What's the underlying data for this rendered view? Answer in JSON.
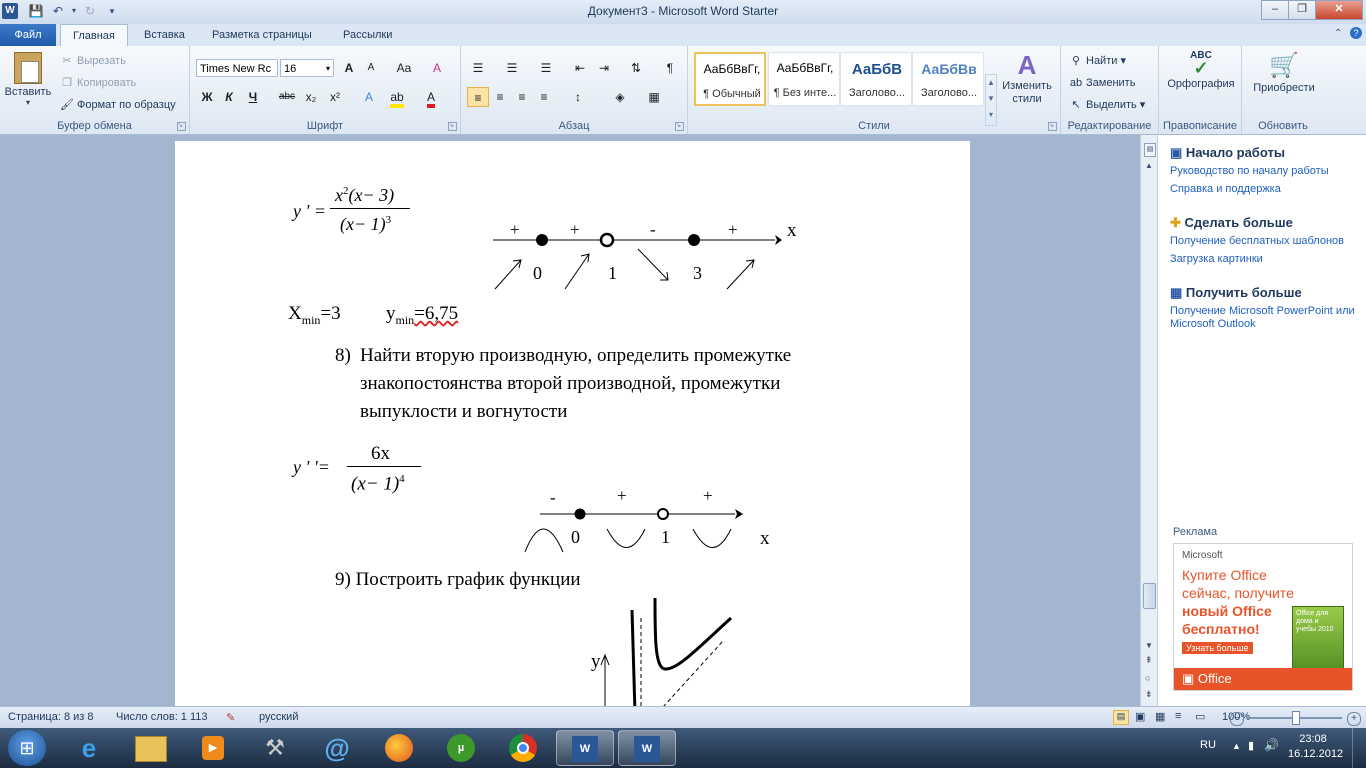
{
  "window": {
    "title": "Документ3  -  Microsoft Word Starter",
    "app_icon": "W"
  },
  "quick_access": [
    "save-icon",
    "undo-icon",
    "redo-icon",
    "customize-icon"
  ],
  "window_controls": {
    "minimize": "–",
    "restore": "❐",
    "close": "✕"
  },
  "tabs": {
    "file": "Файл",
    "home": "Главная",
    "insert": "Вставка",
    "layout": "Разметка страницы",
    "mailings": "Рассылки"
  },
  "ribbon": {
    "clipboard": {
      "label": "Буфер обмена",
      "paste": "Вставить",
      "cut": "Вырезать",
      "copy": "Копировать",
      "format_painter": "Формат по образцу"
    },
    "font": {
      "label": "Шрифт",
      "font_name": "Times New Rc",
      "font_size": "16",
      "bold": "Ж",
      "italic": "К",
      "underline": "Ч",
      "strike": "abc",
      "subscript": "x₂",
      "superscript": "x²",
      "grow": "A",
      "shrink": "A",
      "case": "Aa",
      "clear": "A"
    },
    "paragraph": {
      "label": "Абзац"
    },
    "styles": {
      "label": "Стили",
      "items": [
        {
          "sample": "АаБбВвГг,",
          "name": "¶ Обычный"
        },
        {
          "sample": "АаБбВвГг,",
          "name": "¶ Без инте..."
        },
        {
          "sample": "АаБбВ",
          "name": "Заголово..."
        },
        {
          "sample": "АаБбВв",
          "name": "Заголово..."
        }
      ],
      "change": "Изменить стили"
    },
    "editing": {
      "label": "Редактирование",
      "find": "Найти",
      "replace": "Заменить",
      "select": "Выделить"
    },
    "proofing": {
      "label": "Правописание",
      "spelling": "Орфография"
    },
    "update": {
      "label": "Обновить",
      "purchase": "Приобрести"
    }
  },
  "document": {
    "deriv1_lhs": "y ' =",
    "deriv1_num_a": "x",
    "deriv1_num_sup": "2",
    "deriv1_num_b": "(x− 3)",
    "deriv1_den": "(x− 1)",
    "deriv1_den_sup": "3",
    "signs1": [
      "+",
      "+",
      "-",
      "+"
    ],
    "axis1_label": "x",
    "points1": [
      "0",
      "1",
      "3"
    ],
    "xmin_label": "X",
    "xmin_sub": "min",
    "xmin_value": "=3",
    "ymin_label": "y",
    "ymin_sub": "min",
    "ymin_value": "=6,75",
    "item8_num": "8)",
    "item8_line1": "Найти вторую производную, определить промежутке",
    "item8_line2": "знакопостоянства  второй производной, промежутки",
    "item8_line3": "выпуклости и вогнутости",
    "deriv2_lhs": "y ' '=",
    "deriv2_num": "6x",
    "deriv2_den": "(x− 1)",
    "deriv2_den_sup": "4",
    "signs2": [
      "-",
      "+",
      "+"
    ],
    "axis2_label": "x",
    "points2": [
      "0",
      "1"
    ],
    "item9": "9) Построить график функции",
    "graph_y_label": "y"
  },
  "task_pane": {
    "sections": [
      {
        "title": "Начало работы",
        "icon": "book-icon",
        "links": [
          "Руководство по началу работы",
          "Справка и поддержка"
        ]
      },
      {
        "title": "Сделать больше",
        "icon": "plus-icon",
        "links": [
          "Получение бесплатных шаблонов",
          "Загрузка картинки"
        ]
      },
      {
        "title": "Получить больше",
        "icon": "apps-icon",
        "links": [
          "Получение Microsoft PowerPoint или Microsoft Outlook"
        ]
      }
    ],
    "ad_label": "Реклама",
    "ad": {
      "brand": "Microsoft",
      "line1": "Купите Office",
      "line2": "сейчас, получите",
      "line3": "новый Office",
      "line4": "бесплатно!",
      "cta": "Узнать больше",
      "footer": "Office",
      "box_text": "Office для дома и учебы 2010"
    }
  },
  "status": {
    "page": "Страница: 8 из 8",
    "words": "Число слов: 1 113",
    "language": "русский",
    "zoom": "100%"
  },
  "taskbar": {
    "lang": "RU",
    "time": "23:08",
    "date": "16.12.2012"
  },
  "colors": {
    "ribbon_bg": "#dde7f3",
    "file_tab": "#1e5aa8",
    "link": "#1f5fbf",
    "ad_orange": "#e8542a"
  }
}
